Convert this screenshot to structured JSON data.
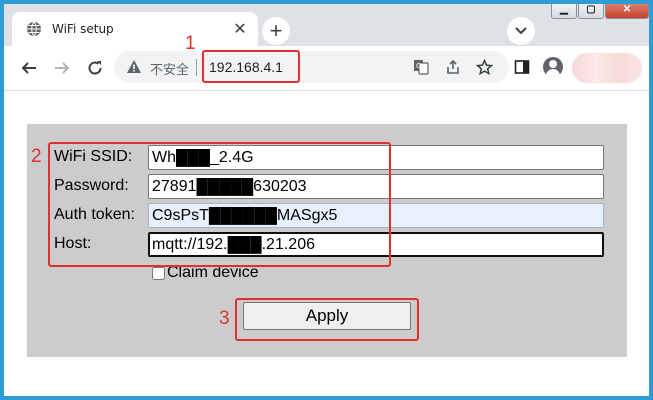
{
  "tab": {
    "title": "WiFi setup",
    "close": "✕",
    "new_tab": "+"
  },
  "window_controls": {
    "minimize": "▁",
    "maximize": "▢",
    "close": "✕"
  },
  "omnibox": {
    "security_label": "不安全",
    "url": "192.168.4.1"
  },
  "form": {
    "ssid": {
      "label": "WiFi SSID:",
      "value": "Wh███_2.4G"
    },
    "password": {
      "label": "Password:",
      "value": "27891█████630203"
    },
    "token": {
      "label": "Auth token:",
      "value": "C9sPsT██████MASgx5"
    },
    "host": {
      "label": "Host:",
      "value": "mqtt://192.███.21.206"
    },
    "claim_label": "Claim device",
    "claim_checked": false,
    "apply_label": "Apply"
  },
  "annotations": {
    "url_box": "1",
    "fields_box": "2",
    "apply_box": "3",
    "color": "#e03030"
  },
  "icons": [
    "globe-icon",
    "close-icon",
    "plus-icon",
    "chevron-down-icon",
    "back-arrow-icon",
    "forward-arrow-icon",
    "reload-icon",
    "warning-icon",
    "translate-icon",
    "share-icon",
    "star-icon",
    "sidepanel-icon",
    "profile-icon"
  ]
}
